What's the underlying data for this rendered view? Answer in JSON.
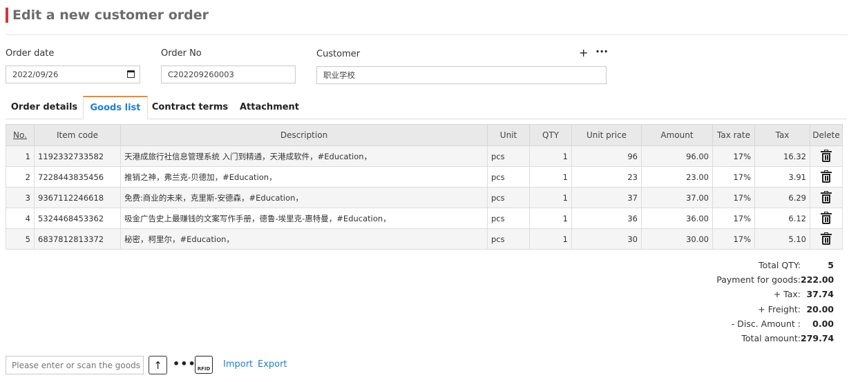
{
  "page": {
    "title": "Edit a new customer order"
  },
  "form": {
    "order_date": {
      "label": "Order date",
      "value": "2022/09/26"
    },
    "order_no": {
      "label": "Order No",
      "value": "C202209260003"
    },
    "customer": {
      "label": "Customer",
      "value": "职业学校",
      "add_label": "+",
      "more_label": "···"
    }
  },
  "tabs": [
    {
      "label": "Order details",
      "active": false
    },
    {
      "label": "Goods list",
      "active": true
    },
    {
      "label": "Contract terms",
      "active": false
    },
    {
      "label": "Attachment",
      "active": false
    }
  ],
  "table": {
    "headers": {
      "no": "No.",
      "item_code": "Item code",
      "description": "Description",
      "unit": "Unit",
      "qty": "QTY",
      "unit_price": "Unit price",
      "amount": "Amount",
      "tax_rate": "Tax rate",
      "tax": "Tax",
      "delete": "Delete"
    },
    "rows": [
      {
        "no": "1",
        "item_code": "1192332733582",
        "description": "天港成旅行社信息管理系统 入门到精通，天港成软件，#Education，",
        "unit": "pcs",
        "qty": "1",
        "unit_price": "96",
        "amount": "96.00",
        "tax_rate": "17%",
        "tax": "16.32"
      },
      {
        "no": "2",
        "item_code": "7228443835456",
        "description": "推销之神，弗兰克-贝德加，#Education，",
        "unit": "pcs",
        "qty": "1",
        "unit_price": "23",
        "amount": "23.00",
        "tax_rate": "17%",
        "tax": "3.91"
      },
      {
        "no": "3",
        "item_code": "9367112246618",
        "description": "免费:商业的未来，克里斯-安德森，#Education，",
        "unit": "pcs",
        "qty": "1",
        "unit_price": "37",
        "amount": "37.00",
        "tax_rate": "17%",
        "tax": "6.29"
      },
      {
        "no": "4",
        "item_code": "5324468453362",
        "description": "吸金广告史上最赚钱的文案写作手册，德鲁-埃里克-惠特曼，#Education，",
        "unit": "pcs",
        "qty": "1",
        "unit_price": "36",
        "amount": "36.00",
        "tax_rate": "17%",
        "tax": "6.12"
      },
      {
        "no": "5",
        "item_code": "6837812813372",
        "description": "秘密，柯里尔，#Education，",
        "unit": "pcs",
        "qty": "1",
        "unit_price": "30",
        "amount": "30.00",
        "tax_rate": "17%",
        "tax": "5.10"
      }
    ]
  },
  "totals": [
    {
      "label": "Total QTY:",
      "value": "5"
    },
    {
      "label": "Payment for goods:",
      "value": "222.00"
    },
    {
      "label": "+ Tax:",
      "value": "37.74"
    },
    {
      "label": "+ Freight:",
      "value": "20.00"
    },
    {
      "label": "- Disc. Amount :",
      "value": "0.00"
    },
    {
      "label": "Total amount:",
      "value": "279.74"
    }
  ],
  "toolbar": {
    "scan_placeholder": "Please enter or scan the goods item",
    "upload_glyph": "↑",
    "more_glyph": "•••",
    "rfid_label": "RFID",
    "import_label": "Import",
    "export_label": "Export"
  },
  "colors": {
    "accent": "#d9343a",
    "link": "#1e7fd6",
    "active_tab_top": "#f08a24"
  }
}
